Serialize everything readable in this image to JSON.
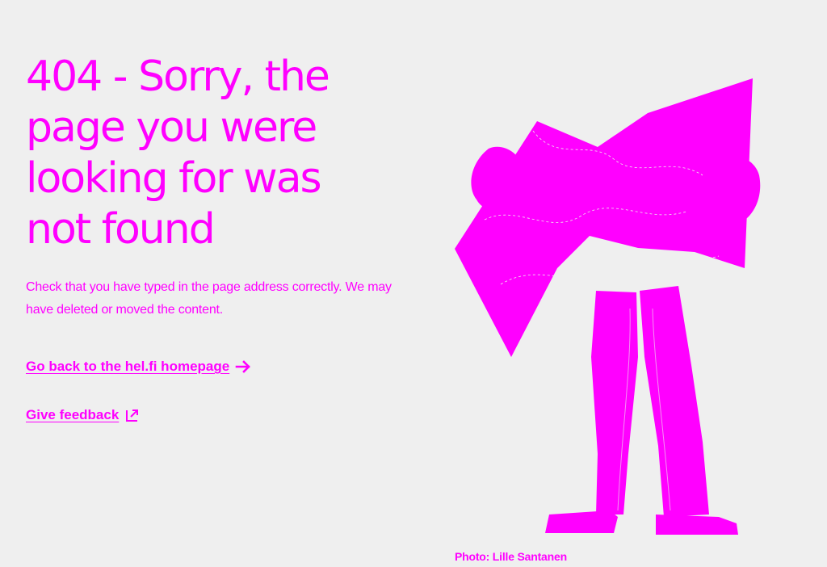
{
  "error": {
    "heading_lines": [
      "404 - Sorry, the",
      "page you were",
      "looking for was",
      "not found"
    ],
    "description": "Check that you have typed in the page address correctly. We may have deleted or moved the content."
  },
  "links": {
    "homepage": "Go back to the hel.fi homepage",
    "feedback": "Give feedback"
  },
  "icons": {
    "homepage": "arrow-right-icon",
    "feedback": "external-link-icon"
  },
  "illustration": {
    "caption": "Photo: Lille Santanen"
  },
  "colors": {
    "accent": "#ff00ff",
    "background": "#efefef"
  }
}
